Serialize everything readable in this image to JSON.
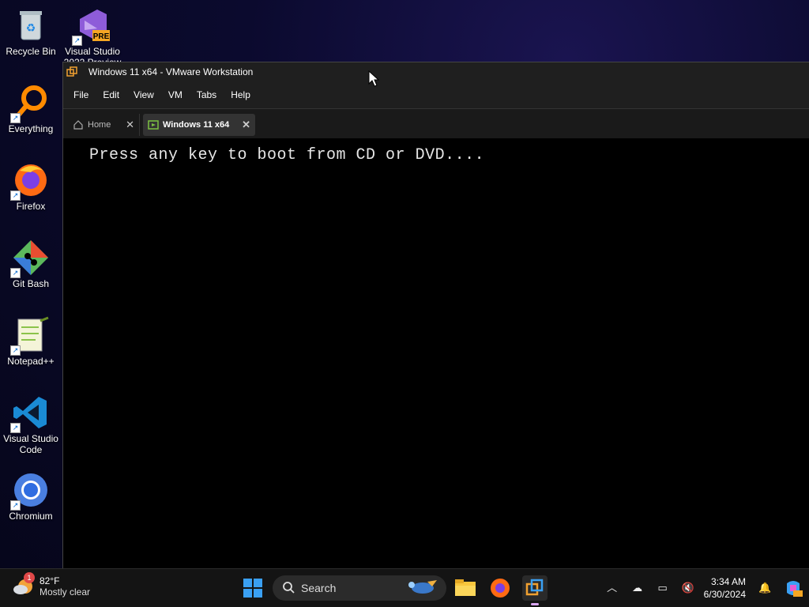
{
  "desktop": {
    "icons": [
      {
        "label": "Recycle Bin"
      },
      {
        "label": "Visual Studio 2022 Preview",
        "badge": "PRE"
      },
      {
        "label": "Everything"
      },
      {
        "label": "Firefox"
      },
      {
        "label": "Git Bash"
      },
      {
        "label": "Notepad++"
      },
      {
        "label": "Visual Studio Code"
      },
      {
        "label": "Chromium"
      }
    ]
  },
  "window": {
    "title": "Windows 11 x64 - VMware Workstation",
    "menu": [
      "File",
      "Edit",
      "View",
      "VM",
      "Tabs",
      "Help"
    ],
    "tabs": [
      {
        "label": "Home",
        "active": false
      },
      {
        "label": "Windows 11 x64",
        "active": true
      }
    ],
    "console_text": "Press any key to boot from CD or DVD...."
  },
  "taskbar": {
    "weather_temp": "82°F",
    "weather_desc": "Mostly clear",
    "weather_badge": "1",
    "search_placeholder": "Search",
    "time": "3:34 AM",
    "date": "6/30/2024"
  },
  "colors": {
    "accent": "#0078d4",
    "window_bg": "#1f1f1f",
    "console_bg": "#000000"
  }
}
